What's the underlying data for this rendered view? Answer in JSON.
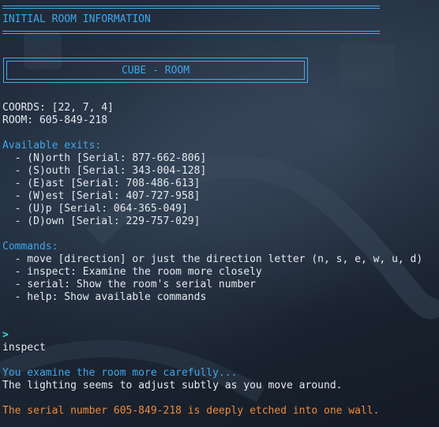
{
  "header": {
    "title": "INITIAL ROOM INFORMATION",
    "room_banner": "CUBE - ROOM"
  },
  "room": {
    "coords": "COORDS: [22, 7, 4]",
    "id": "ROOM: 605-849-218"
  },
  "exits": {
    "heading": "Available exits:",
    "items": [
      "  - (N)orth [Serial: 877-662-806]",
      "  - (S)outh [Serial: 343-004-128]",
      "  - (E)ast [Serial: 708-486-613]",
      "  - (W)est [Serial: 407-727-958]",
      "  - (U)p [Serial: 064-365-049]",
      "  - (D)own [Serial: 229-757-029]"
    ]
  },
  "commands": {
    "heading": "Commands:",
    "items": [
      "  - move [direction] or just the direction letter (n, s, e, w, u, d)",
      "  - inspect: Examine the room more closely",
      "  - serial: Show the room's serial number",
      "  - help: Show available commands"
    ]
  },
  "prompt": {
    "symbol": ">",
    "input": "inspect"
  },
  "output": {
    "examine": "You examine the room more carefully...",
    "lighting": "The lighting seems to adjust subtly as you move around.",
    "serial_note": "The serial number 605-849-218 is deeply etched into one wall."
  },
  "colors": {
    "accent_blue": "#3fa7ea",
    "warning_orange": "#ef8a3b",
    "prompt_cyan": "#38d9e0",
    "text": "#e6e9ee"
  }
}
